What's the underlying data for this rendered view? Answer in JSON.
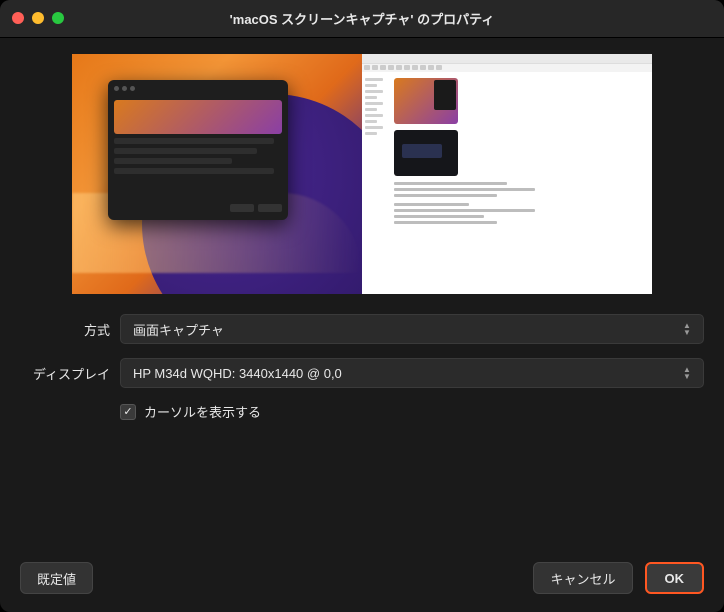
{
  "window": {
    "title": "'macOS スクリーンキャプチャ' のプロパティ"
  },
  "form": {
    "method_label": "方式",
    "method_value": "画面キャプチャ",
    "display_label": "ディスプレイ",
    "display_value": "HP M34d WQHD: 3440x1440 @ 0,0",
    "cursor_checkbox_label": "カーソルを表示する",
    "cursor_checked": true
  },
  "buttons": {
    "defaults": "既定値",
    "cancel": "キャンセル",
    "ok": "OK"
  }
}
